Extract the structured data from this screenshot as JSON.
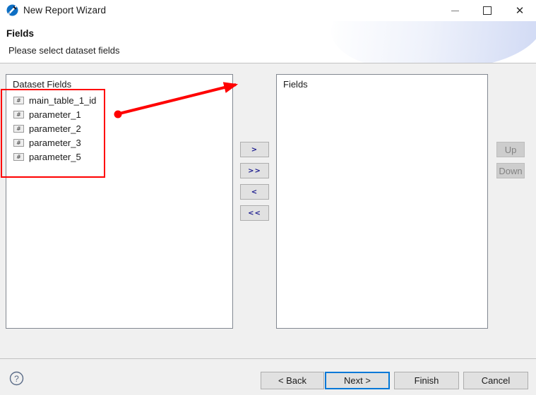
{
  "window": {
    "title": "New Report Wizard",
    "icon": "report-wizard-icon",
    "controls": {
      "minimize": "minimize-icon",
      "maximize": "maximize-icon",
      "close": "close-icon"
    }
  },
  "header": {
    "title": "Fields",
    "subtitle": "Please select dataset fields"
  },
  "left_panel": {
    "caption": "Dataset Fields",
    "items": [
      {
        "label": "main_table_1_id",
        "icon": "#"
      },
      {
        "label": "parameter_1",
        "icon": "#"
      },
      {
        "label": "parameter_2",
        "icon": "#"
      },
      {
        "label": "parameter_3",
        "icon": "#"
      },
      {
        "label": "parameter_5",
        "icon": "#"
      }
    ]
  },
  "right_panel": {
    "caption": "Fields",
    "items": []
  },
  "transfer_buttons": [
    {
      "label": ">",
      "name": "move-right-button"
    },
    {
      "label": ">>",
      "name": "move-all-right-button"
    },
    {
      "label": "<",
      "name": "move-left-button"
    },
    {
      "label": "<<",
      "name": "move-all-left-button"
    }
  ],
  "order_buttons": [
    {
      "label": "Up",
      "enabled": false
    },
    {
      "label": "Down",
      "enabled": false
    }
  ],
  "footer": {
    "help": "?",
    "back": "< Back",
    "next": "Next >",
    "finish": "Finish",
    "cancel": "Cancel"
  },
  "annotations": {
    "highlight_color": "#ff0000",
    "arrow_from": "dataset-fields-list",
    "arrow_to": "move-right-button"
  }
}
